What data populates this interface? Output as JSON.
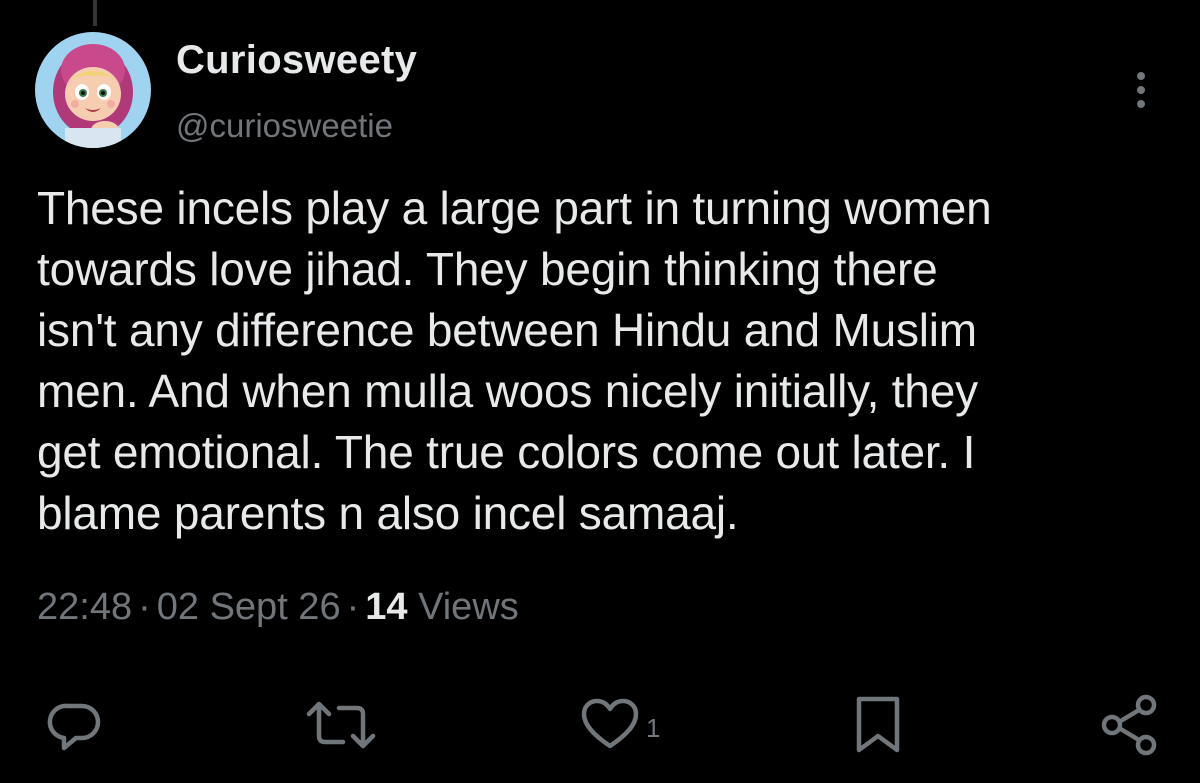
{
  "author": {
    "display_name": "Curiosweety",
    "handle": "@curiosweetie",
    "avatar_icon": "cartoon-girl-avatar"
  },
  "tweet": {
    "text": "These incels play a large part in turning women\ntowards love jihad. They begin thinking there\nisn't any difference between Hindu and Muslim\nmen. And when mulla woos nicely initially, they\nget emotional. The true colors come out later. I\nblame parents n also incel samaaj."
  },
  "meta": {
    "time": "22:48",
    "separator": "·",
    "date": "02 Sept 26",
    "views_count": "14",
    "views_label": "Views"
  },
  "actions": {
    "reply_icon": "reply-icon",
    "retweet_icon": "retweet-icon",
    "like_icon": "heart-icon",
    "like_count": "1",
    "bookmark_icon": "bookmark-icon",
    "share_icon": "share-icon"
  },
  "colors": {
    "background": "#000000",
    "text_primary": "#e7e9ea",
    "text_secondary": "#71767b"
  }
}
